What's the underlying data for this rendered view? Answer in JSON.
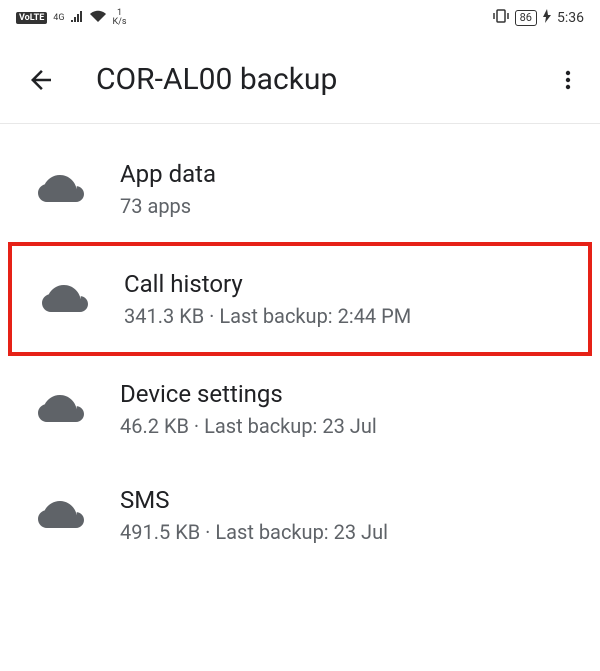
{
  "status_bar": {
    "volte": "VoLTE",
    "network": "4G",
    "speed_num": "1",
    "speed_unit": "K/s",
    "battery": "86",
    "time": "5:36"
  },
  "header": {
    "title": "COR-AL00 backup"
  },
  "items": [
    {
      "title": "App data",
      "subtitle": "73 apps",
      "highlighted": false
    },
    {
      "title": "Call history",
      "subtitle": "341.3 KB · Last backup: 2:44 PM",
      "highlighted": true
    },
    {
      "title": "Device settings",
      "subtitle": "46.2 KB · Last backup: 23 Jul",
      "highlighted": false
    },
    {
      "title": "SMS",
      "subtitle": "491.5 KB · Last backup: 23 Jul",
      "highlighted": false
    }
  ]
}
